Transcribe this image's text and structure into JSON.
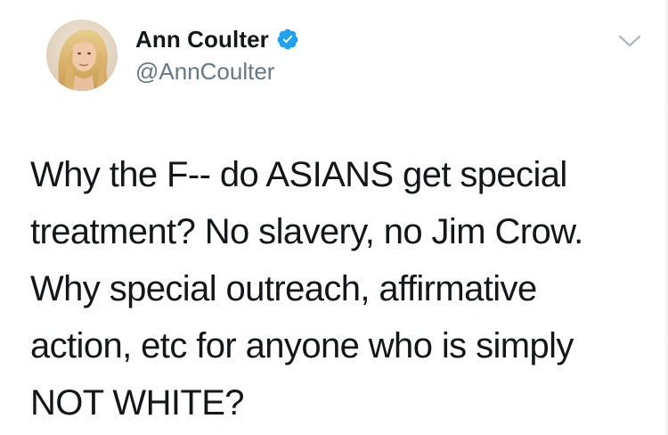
{
  "user": {
    "display_name": "Ann Coulter",
    "handle": "@AnnCoulter",
    "verified": true
  },
  "tweet": {
    "lines": [
      "Why the F-- do ASIANS get special",
      "treatment?  No slavery, no Jim Crow.",
      "Why special outreach, affirmative",
      "action, etc for anyone who is simply",
      "NOT WHITE?"
    ]
  },
  "icons": {
    "avatar": "profile-photo",
    "verified": "verified-badge-icon",
    "menu": "chevron-down-icon"
  },
  "colors": {
    "verified_blue": "#1da1f2",
    "text": "#14171a",
    "secondary": "#657786"
  }
}
